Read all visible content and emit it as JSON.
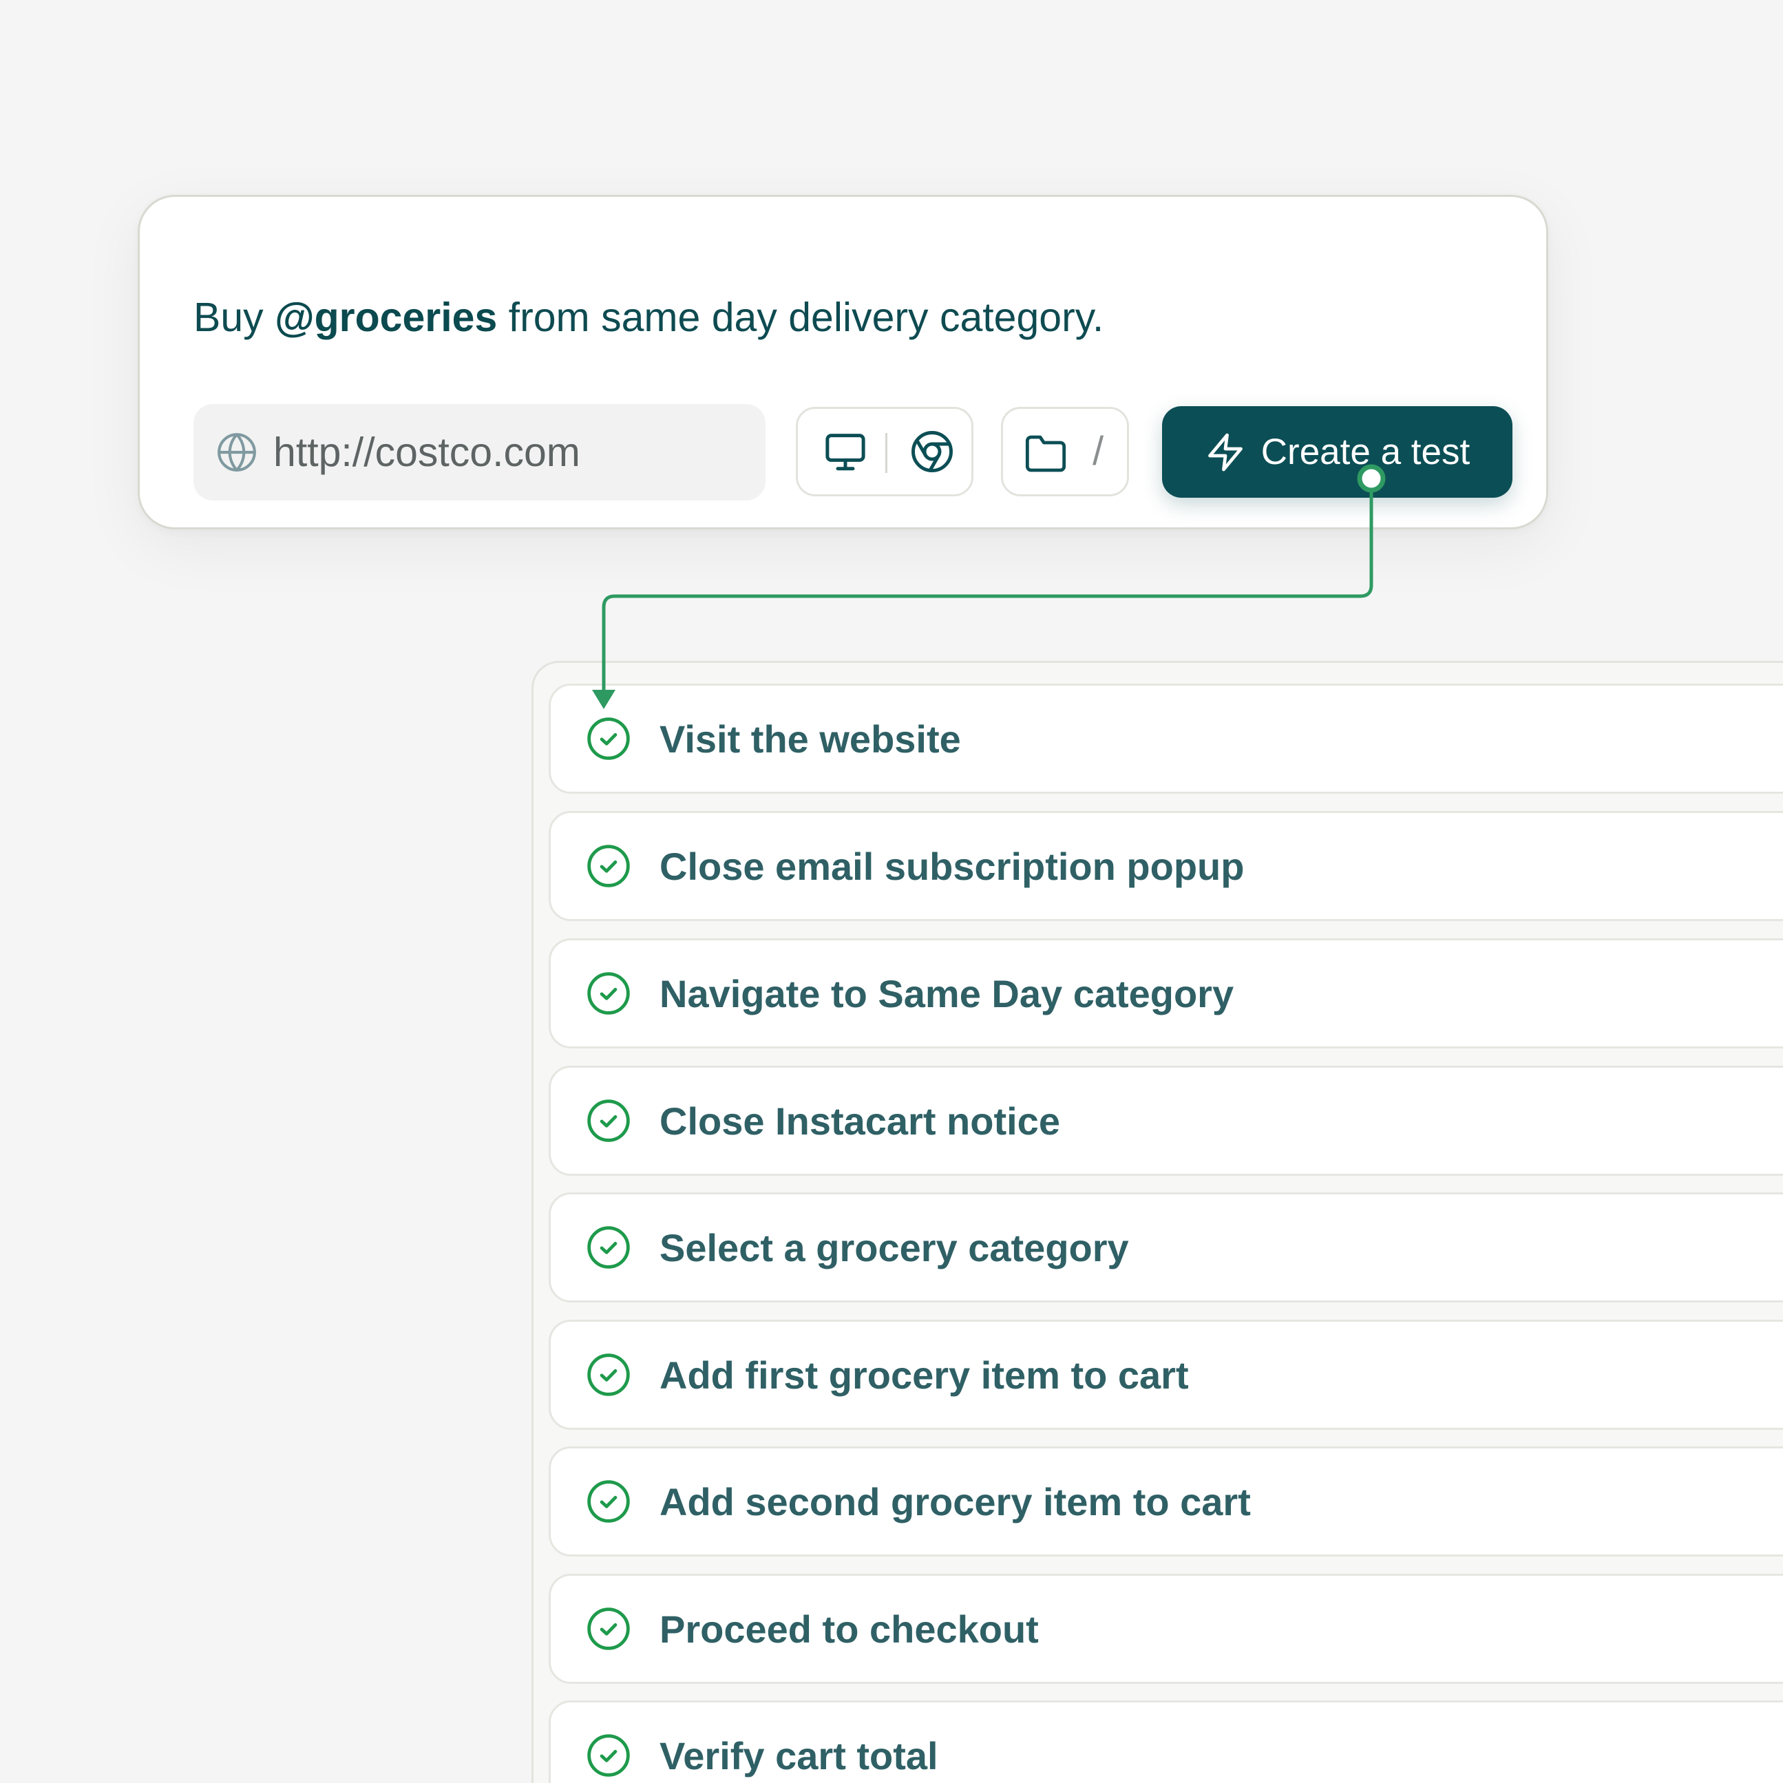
{
  "prompt": {
    "prefix": "Buy",
    "mention": "@groceries",
    "suffix": "from same day delivery category."
  },
  "url_field": {
    "value": "http://costco.com",
    "icon": "globe-icon"
  },
  "environment": {
    "device_icon": "monitor-icon",
    "browser_icon": "chrome-icon"
  },
  "folder": {
    "icon": "folder-icon",
    "path": "/"
  },
  "create_button": {
    "label": "Create a test",
    "icon": "lightning-icon"
  },
  "steps": [
    {
      "label": "Visit the website",
      "status": "done"
    },
    {
      "label": "Close email subscription popup",
      "status": "done"
    },
    {
      "label": "Navigate to Same Day category",
      "status": "done"
    },
    {
      "label": "Close Instacart notice",
      "status": "done"
    },
    {
      "label": "Select a grocery category",
      "status": "done"
    },
    {
      "label": "Add first grocery item to cart",
      "status": "done"
    },
    {
      "label": "Add second grocery item to cart",
      "status": "done"
    },
    {
      "label": "Proceed to checkout",
      "status": "done"
    },
    {
      "label": "Verify cart total",
      "status": "done"
    }
  ],
  "colors": {
    "background": "#f5f5f5",
    "primary": "#0c4e55",
    "text": "#0e4b51",
    "step_text": "#2f6065",
    "success": "#1e9a4b",
    "connector": "#2e9a62"
  }
}
